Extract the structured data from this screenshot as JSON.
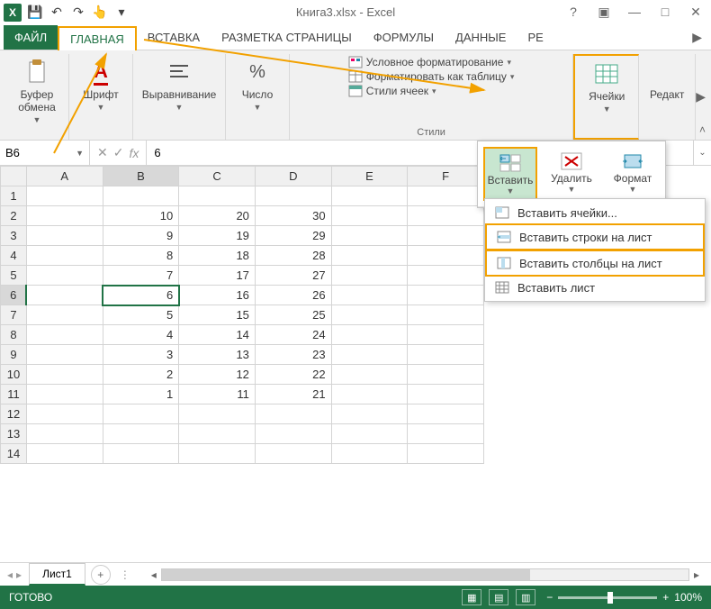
{
  "title": "Книга3.xlsx - Excel",
  "tabs": {
    "file": "ФАЙЛ",
    "home": "ГЛАВНАЯ",
    "insert": "ВСТАВКА",
    "layout": "РАЗМЕТКА СТРАНИЦЫ",
    "formulas": "ФОРМУЛЫ",
    "data": "ДАННЫЕ",
    "review": "РЕ"
  },
  "ribbon": {
    "clipboard": "Буфер обмена",
    "font": "Шрифт",
    "align": "Выравнивание",
    "number": "Число",
    "cond_fmt": "Условное форматирование",
    "fmt_table": "Форматировать как таблицу",
    "cell_styles": "Стили ячеек",
    "styles_label": "Стили",
    "cells": "Ячейки",
    "edit": "Редакт"
  },
  "cells_panel": {
    "insert": "Вставить",
    "delete": "Удалить",
    "format": "Формат"
  },
  "cells_menu": {
    "insert_cells": "Вставить ячейки...",
    "insert_rows": "Вставить строки на лист",
    "insert_cols": "Вставить столбцы на лист",
    "insert_sheet": "Вставить лист"
  },
  "namebox": "B6",
  "formula": "6",
  "columns": [
    "A",
    "B",
    "C",
    "D",
    "E",
    "F"
  ],
  "rows": [
    1,
    2,
    3,
    4,
    5,
    6,
    7,
    8,
    9,
    10,
    11,
    12,
    13,
    14
  ],
  "chart_data": {
    "type": "table",
    "columns": [
      "A",
      "B",
      "C",
      "D",
      "E",
      "F"
    ],
    "data": [
      [
        "",
        "",
        "",
        "",
        "",
        ""
      ],
      [
        "",
        10,
        20,
        30,
        "",
        ""
      ],
      [
        "",
        9,
        19,
        29,
        "",
        ""
      ],
      [
        "",
        8,
        18,
        28,
        "",
        ""
      ],
      [
        "",
        7,
        17,
        27,
        "",
        ""
      ],
      [
        "",
        6,
        16,
        26,
        "",
        ""
      ],
      [
        "",
        5,
        15,
        25,
        "",
        ""
      ],
      [
        "",
        4,
        14,
        24,
        "",
        ""
      ],
      [
        "",
        3,
        13,
        23,
        "",
        ""
      ],
      [
        "",
        2,
        12,
        22,
        "",
        ""
      ],
      [
        "",
        1,
        11,
        21,
        "",
        ""
      ],
      [
        "",
        "",
        "",
        "",
        "",
        ""
      ],
      [
        "",
        "",
        "",
        "",
        "",
        ""
      ],
      [
        "",
        "",
        "",
        "",
        "",
        ""
      ]
    ],
    "selected_cell": "B6"
  },
  "sheet": "Лист1",
  "status": "ГОТОВО",
  "zoom": "100%"
}
